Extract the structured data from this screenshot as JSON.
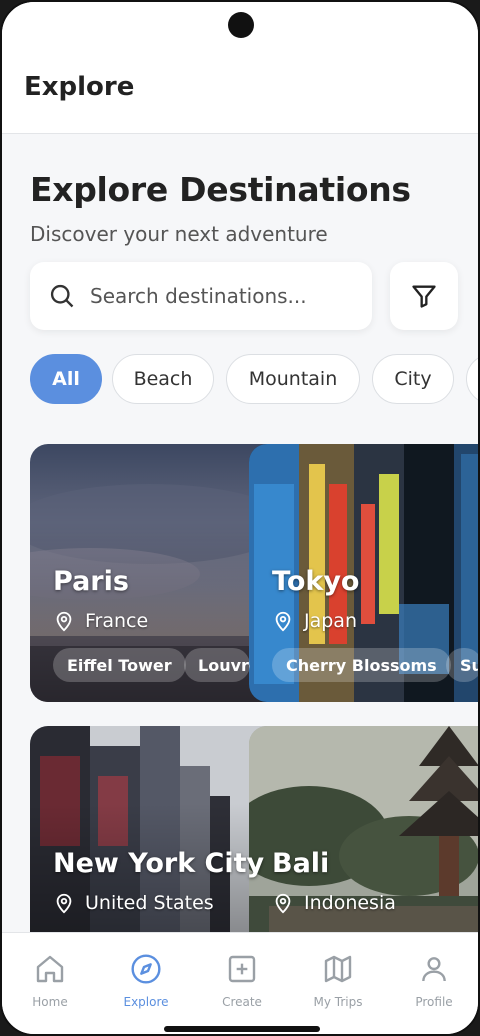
{
  "app_bar": {
    "title": "Explore"
  },
  "header": {
    "title": "Explore Destinations",
    "subtitle": "Discover your next adventure"
  },
  "search": {
    "placeholder": "Search destinations...",
    "value": ""
  },
  "filter": {
    "icon": "filter-icon"
  },
  "categories": [
    "All",
    "Beach",
    "Mountain",
    "City"
  ],
  "selected_category": "All",
  "destinations": [
    {
      "name": "Paris",
      "country": "France",
      "tags": [
        "Eiffel Tower",
        "Louvre"
      ]
    },
    {
      "name": "Tokyo",
      "country": "Japan",
      "tags": [
        "Cherry Blossoms",
        "Su"
      ]
    },
    {
      "name": "New York City",
      "country": "United States",
      "tags": []
    },
    {
      "name": "Bali",
      "country": "Indonesia",
      "tags": []
    }
  ],
  "bottom_nav": [
    {
      "label": "Home",
      "icon": "home-icon"
    },
    {
      "label": "Explore",
      "icon": "compass-icon",
      "active": true
    },
    {
      "label": "Create",
      "icon": "plus-square-icon"
    },
    {
      "label": "My Trips",
      "icon": "map-icon"
    },
    {
      "label": "Profile",
      "icon": "user-icon"
    }
  ],
  "colors": {
    "accent": "#5b8fdf",
    "background": "#f6f7f9"
  }
}
